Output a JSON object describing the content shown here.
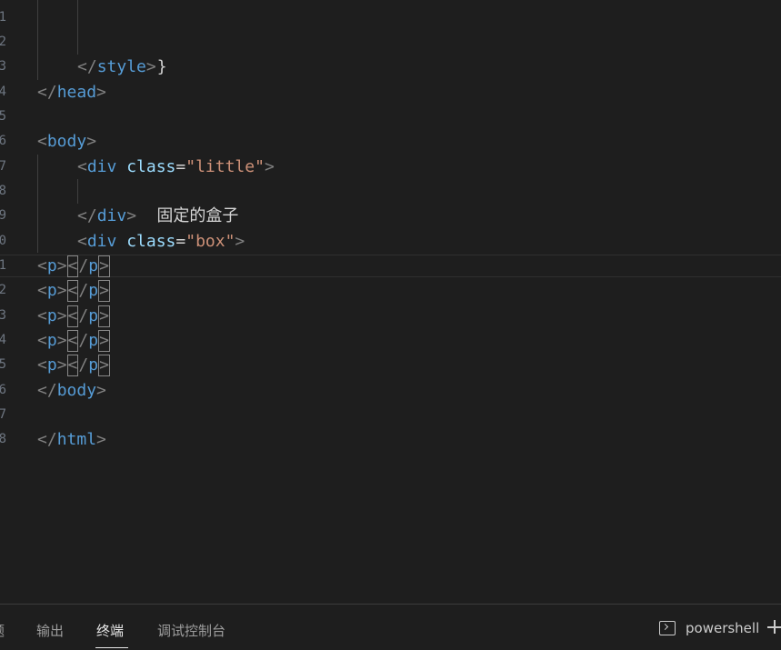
{
  "editor": {
    "line_numbers": [
      "1",
      "2",
      "3",
      "4",
      "5",
      "6",
      "7",
      "8",
      "9",
      "0",
      "1",
      "2",
      "3",
      "4",
      "5",
      "6",
      "7",
      "8"
    ],
    "lines": {
      "brace": "}",
      "style_close_open": "</",
      "style_close_tag": "style",
      "style_close_end": ">",
      "head_close_open": "</",
      "head_close_tag": "head",
      "head_close_end": ">",
      "body_open_open": "<",
      "body_open_tag": "body",
      "body_open_end": ">",
      "div1_open": "<",
      "div1_tag": "div",
      "div1_attr": "class",
      "div1_eq": "=",
      "div1_val": "\"little\"",
      "div1_end": ">",
      "div1_text": "固定的盒子",
      "div1_close_open": "</",
      "div1_close_tag": "div",
      "div1_close_end": ">",
      "div2_open": "<",
      "div2_tag": "div",
      "div2_attr": "class",
      "div2_eq": "=",
      "div2_val": "\"box\"",
      "div2_end": ">",
      "p_open_lt": "<",
      "p_tag": "p",
      "p_open_gt": ">",
      "p_close_lt": "<",
      "p_close_slash": "/",
      "p_close_gt": ">",
      "body_close_open": "</",
      "body_close_tag": "body",
      "body_close_end": ">",
      "html_close_open": "</",
      "html_close_tag": "html",
      "html_close_end": ">"
    }
  },
  "panel": {
    "tabs": [
      {
        "label": "题"
      },
      {
        "label": "输出"
      },
      {
        "label": "终端"
      },
      {
        "label": "调试控制台"
      }
    ],
    "active_tab": "终端",
    "terminal_label": "powershell"
  },
  "colors": {
    "background": "#1e1e1e",
    "tag": "#569cd6",
    "attribute": "#9cdcfe",
    "string": "#ce9178",
    "punctuation": "#808080",
    "text": "#d4d4d4"
  }
}
